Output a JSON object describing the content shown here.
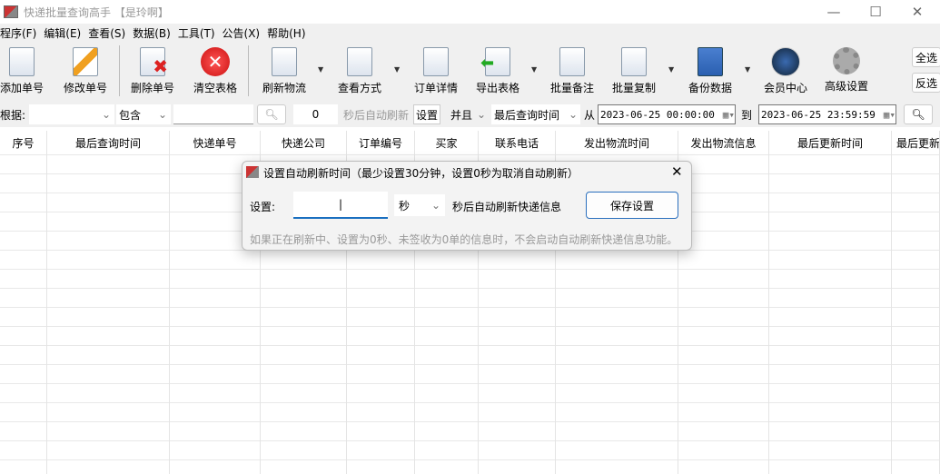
{
  "window": {
    "title": "快递批量查询高手 【是玲啊】",
    "minimize": "—",
    "maximize": "☐",
    "close": "✕"
  },
  "menu": [
    "程序(F)",
    "编辑(E)",
    "查看(S)",
    "数据(B)",
    "工具(T)",
    "公告(X)",
    "帮助(H)"
  ],
  "toolbar": {
    "add": "添加单号",
    "edit": "修改单号",
    "delete": "删除单号",
    "clear": "清空表格",
    "refresh": "刷新物流",
    "view": "查看方式",
    "detail": "订单详情",
    "export": "导出表格",
    "note": "批量备注",
    "copy": "批量复制",
    "backup": "备份数据",
    "member": "会员中心",
    "settings": "高级设置",
    "select_all": "全选",
    "invert": "反选"
  },
  "filter": {
    "by_label": "根据:",
    "by_value": "",
    "op": "包含",
    "keyword": "",
    "seconds": "0",
    "auto_label": "秒后自动刷新",
    "set_btn": "设置",
    "logic": "并且",
    "time_field": "最后查询时间",
    "from_label": "从",
    "from": "2023-06-25 00:00:00",
    "to_label": "到",
    "to": "2023-06-25 23:59:59"
  },
  "table": {
    "headers": [
      "序号",
      "最后查询时间",
      "快递单号",
      "快递公司",
      "订单编号",
      "买家",
      "联系电话",
      "发出物流时间",
      "发出物流信息",
      "最后更新时间",
      "最后更新"
    ]
  },
  "dialog": {
    "title": "设置自动刷新时间（最少设置30分钟，设置0秒为取消自动刷新）",
    "close": "✕",
    "set_label": "设置:",
    "value": "",
    "unit": "秒",
    "after": "秒后自动刷新快递信息",
    "save": "保存设置",
    "note": "如果正在刷新中、设置为0秒、未签收为0单的信息时，不会启动自动刷新快递信息功能。"
  }
}
